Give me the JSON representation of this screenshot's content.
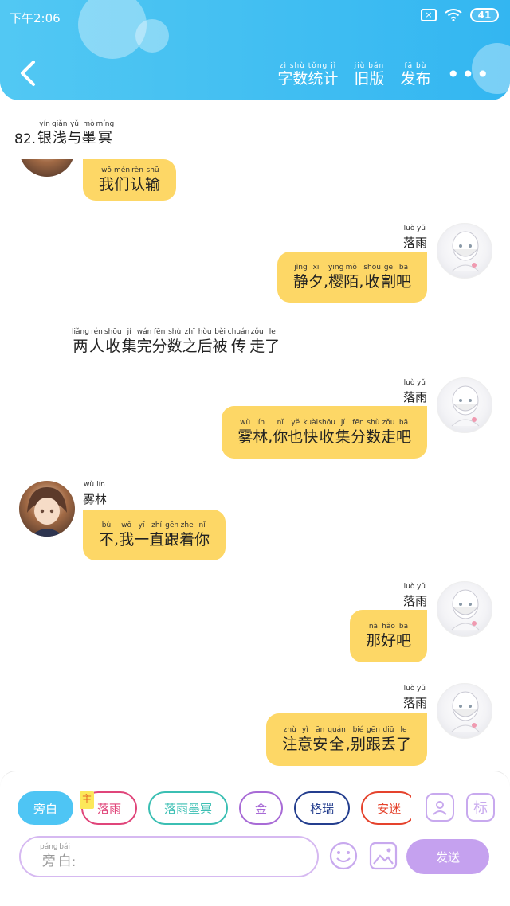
{
  "status": {
    "time": "下午2:06",
    "battery": "41"
  },
  "header": {
    "actions": [
      {
        "py": "zì shù tǒng jì",
        "hz": "字数统计"
      },
      {
        "py": "jiù bǎn",
        "hz": "旧版"
      },
      {
        "py": "fā bù",
        "hz": "发布"
      }
    ],
    "more": "•••"
  },
  "chapter": {
    "num": "82.",
    "title": [
      [
        "yín",
        "银"
      ],
      [
        "qiǎn",
        "浅"
      ],
      [
        "yǔ",
        "与"
      ],
      [
        "mò",
        "墨"
      ],
      [
        "míng",
        "冥"
      ]
    ]
  },
  "messages": [
    {
      "kind": "left",
      "text": [
        [
          "wǒ",
          "我"
        ],
        [
          "mén",
          "们"
        ],
        [
          "rèn",
          "认"
        ],
        [
          "shū",
          "输"
        ]
      ]
    },
    {
      "kind": "right",
      "name": [
        [
          "luò",
          "落"
        ],
        [
          "yǔ",
          "雨"
        ]
      ],
      "text": [
        [
          "jìng",
          "静"
        ],
        [
          "xī",
          "夕"
        ],
        [
          "",
          ","
        ],
        [
          "yīng",
          "樱"
        ],
        [
          "mò",
          "陌"
        ],
        [
          "",
          ","
        ],
        [
          "shōu",
          "收"
        ],
        [
          "gē",
          "割"
        ],
        [
          "bā",
          "吧"
        ]
      ]
    },
    {
      "kind": "narration",
      "text": [
        [
          "liǎng",
          "两"
        ],
        [
          "rén",
          "人"
        ],
        [
          "shōu",
          "收"
        ],
        [
          "jí",
          "集"
        ],
        [
          "wán",
          "完"
        ],
        [
          "fēn",
          "分"
        ],
        [
          "shù",
          "数"
        ],
        [
          "zhī",
          "之"
        ],
        [
          "hòu",
          "后"
        ],
        [
          "bèi",
          "被"
        ],
        [
          "chuán",
          "传"
        ],
        [
          "zǒu",
          "走"
        ],
        [
          "le",
          "了"
        ]
      ]
    },
    {
      "kind": "right",
      "name": [
        [
          "luò",
          "落"
        ],
        [
          "yǔ",
          "雨"
        ]
      ],
      "text": [
        [
          "wù",
          "雾"
        ],
        [
          "lín",
          "林"
        ],
        [
          "",
          ","
        ],
        [
          "nǐ",
          "你"
        ],
        [
          "yě",
          "也"
        ],
        [
          "kuài",
          "快"
        ],
        [
          "shōu",
          "收"
        ],
        [
          "jí",
          "集"
        ],
        [
          "fēn",
          "分"
        ],
        [
          "shù",
          "数"
        ],
        [
          "zǒu",
          "走"
        ],
        [
          "bā",
          "吧"
        ]
      ]
    },
    {
      "kind": "left",
      "name": [
        [
          "wù",
          "雾"
        ],
        [
          "lín",
          "林"
        ]
      ],
      "text": [
        [
          "bù",
          "不"
        ],
        [
          "",
          ","
        ],
        [
          "wǒ",
          "我"
        ],
        [
          "yī",
          "一"
        ],
        [
          "zhí",
          "直"
        ],
        [
          "gēn",
          "跟"
        ],
        [
          "zhe",
          "着"
        ],
        [
          "nǐ",
          "你"
        ]
      ]
    },
    {
      "kind": "right",
      "name": [
        [
          "luò",
          "落"
        ],
        [
          "yǔ",
          "雨"
        ]
      ],
      "text": [
        [
          "nà",
          "那"
        ],
        [
          "hǎo",
          "好"
        ],
        [
          "bā",
          "吧"
        ]
      ]
    },
    {
      "kind": "right",
      "name": [
        [
          "luò",
          "落"
        ],
        [
          "yǔ",
          "雨"
        ]
      ],
      "text": [
        [
          "zhù",
          "注"
        ],
        [
          "yì",
          "意"
        ],
        [
          "ān",
          "安"
        ],
        [
          "quán",
          "全"
        ],
        [
          "",
          ","
        ],
        [
          "bié",
          "别"
        ],
        [
          "gēn",
          "跟"
        ],
        [
          "diū",
          "丢"
        ],
        [
          "le",
          "了"
        ]
      ]
    }
  ],
  "chips": [
    {
      "label": "旁白",
      "color": "#4ec5f4",
      "active": true
    },
    {
      "label": "落雨",
      "color": "#e0457a",
      "active": false
    },
    {
      "label": "落雨墨冥",
      "color": "#3bbfb3",
      "active": false
    },
    {
      "label": "金",
      "color": "#a86bd6",
      "active": false
    },
    {
      "label": "格瑞",
      "color": "#243e8e",
      "active": false
    },
    {
      "label": "安迷",
      "color": "#e5432d",
      "active": false
    }
  ],
  "zhu_badge": "主",
  "side_icons": {
    "role_icon": "person-card-icon",
    "mark_label": "标"
  },
  "composer": {
    "placeholder": [
      [
        "páng",
        "旁"
      ],
      [
        "bái",
        "白"
      ]
    ],
    "suffix": ":",
    "send_label": "发送"
  },
  "colors": {
    "header": "#45c0f3",
    "bubble": "#fdd766",
    "accent": "#c5a1ef"
  }
}
